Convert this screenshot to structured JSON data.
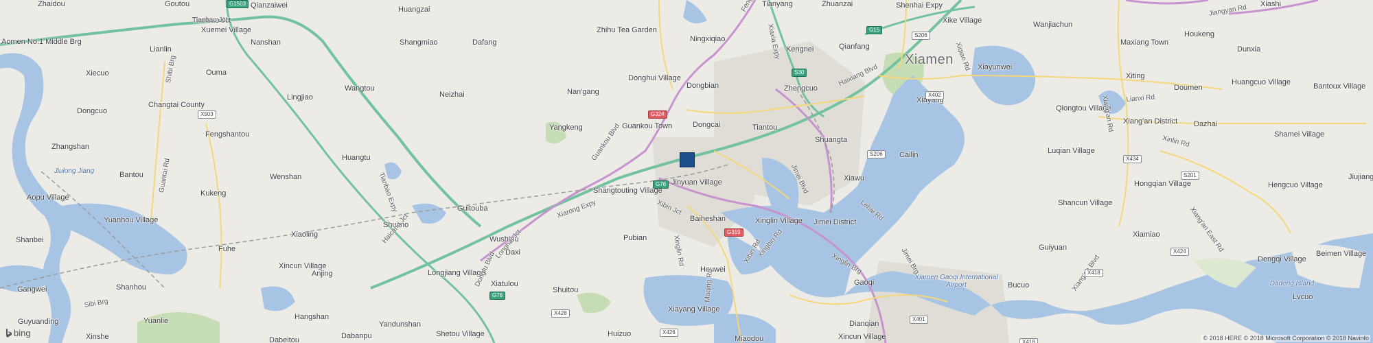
{
  "map": {
    "city": "Xiamen",
    "place_labels": [
      "Zhaidou",
      "Goutou",
      "Qianzaiwei",
      "Huangzai",
      "Tianyang",
      "Zhuanzai",
      "Shenhai Expy",
      "Xike Village",
      "Wanjiachun",
      "Maxiang Town",
      "Houkeng",
      "Dunxia",
      "Xiashi",
      "Aomen No.1 Middle Brg",
      "Tianbao Jct",
      "Xuemei Village",
      "Nanshan",
      "Shangmiao",
      "Dafang",
      "Zhihu Tea Garden",
      "Ningxiqiao",
      "Kengnei",
      "Qianfang",
      "Lianlin",
      "Ouma",
      "Xiecuo",
      "Wangtou",
      "Neizhai",
      "Nan'gang",
      "Donghui Village",
      "Dongbian",
      "Zhengcuo",
      "Xiayang",
      "Xiayunwei",
      "Xiting",
      "Doumen",
      "Huangcuo Village",
      "Bantoux Village",
      "Changtai County",
      "Dongcuo",
      "Lingjiao",
      "Guankou Town",
      "Yangkeng",
      "Qiongtou Village",
      "Xiang'an District",
      "Dazhai",
      "Shamei Village",
      "Fengshantou",
      "Zhangshan",
      "Tiantou",
      "Dongcai",
      "Shuangta",
      "Cailin",
      "Luqian Village",
      "Huangtu",
      "Bantou",
      "Wenshan",
      "Shangtouting Village",
      "Jinyuan Village",
      "Xiawu",
      "Hongqian Village",
      "Hengcuo Village",
      "Jiujiang Village",
      "Kukeng",
      "Aopu Village",
      "Yuanhou Village",
      "Guitouba",
      "Baiheshan",
      "Xinglin Village",
      "Jimei District",
      "Shancun Village",
      "Pubian",
      "Shuimo",
      "Xiaoling",
      "Wushipu",
      "Pubian",
      "Xiamiao",
      "Shanbei",
      "Fuhe",
      "Daxi",
      "Xincun Village",
      "Guiyuan",
      "Dengqi Village",
      "Beimen Village",
      "Anjing",
      "Longjiang Village",
      "Houwei",
      "Gaoqi",
      "Bucuo",
      "Lvcuo",
      "Gangwei",
      "Shanhou",
      "Xiatulou",
      "Shuitou",
      "Hangshan",
      "Xiayang Village",
      "Dianqian",
      "Guyuanding",
      "Yuanlie",
      "Yandunshan",
      "Xinshe",
      "Dabeitou",
      "Dabanpu",
      "Shetou Village",
      "Huizuo",
      "Miaodou",
      "Xincun Village"
    ],
    "road_labels": [
      "Fengnan Rd",
      "Xiaxia Expy",
      "Tianbao Jct",
      "Haicang Jct",
      "Tianbao Expy",
      "Guankou Blvd",
      "Xiarong Expy",
      "Xibin Jct",
      "Longhai Jct",
      "Dongfu Blvd",
      "Xinglin Rd",
      "Xinglin Brg",
      "Jimei Blvd",
      "Haixiang Blvd",
      "Lehai Rd",
      "Jimei Brg",
      "Xiang'an Blvd",
      "Xiang'an Rd",
      "Xiang'an East Rd",
      "Xinlin Rd",
      "Lianxi Rd",
      "Jiangyan Rd",
      "Maqing Rd",
      "Xibin Rd",
      "Xingbin Rd",
      "Shibi Brg",
      "Guantai Rd",
      "Sibi Brg",
      "Xiqiao Rd",
      "Lianxi Rd"
    ],
    "road_shields": [
      "G15",
      "G1503",
      "S206",
      "G15",
      "S30",
      "G324",
      "G76",
      "G319",
      "X402",
      "S206",
      "X434",
      "S201",
      "X418",
      "X424",
      "X428",
      "X426",
      "X401",
      "X418",
      "X503",
      "G76"
    ],
    "water_labels": [
      "Jiulong Jiang",
      "Xiamen Gaoqi International Airport",
      "Dadeng Island"
    ],
    "marker_name": "location-marker",
    "attribution": "© 2018 HERE © 2018 Microsoft Corporation © 2018 Navinfo",
    "logo": "bing",
    "colors": {
      "land": "#ecebe6",
      "water": "#a8c4e4",
      "park": "#c6dcb4",
      "urban": "#e0ddd6",
      "highway": "#72c2a0",
      "arterial": "#c693cf",
      "marker": "#1f4f8a"
    }
  }
}
